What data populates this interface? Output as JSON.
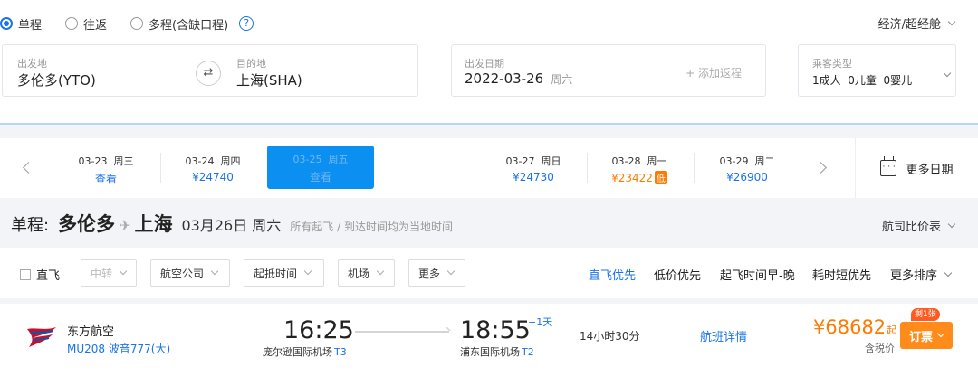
{
  "trip_types": [
    "单程",
    "往返",
    "多程(含缺口程)"
  ],
  "cabin": "经济/超经舱",
  "search": {
    "from_label": "出发地",
    "from_value": "多伦多(YTO)",
    "to_label": "目的地",
    "to_value": "上海(SHA)",
    "date_label": "出发日期",
    "date_value": "2022-03-26",
    "date_weekday": "周六",
    "add_return": "+ 添加返程",
    "pax_label": "乘客类型",
    "pax_value": "1成人  0儿童  0婴儿"
  },
  "dates": [
    {
      "date": "03-23  周三",
      "price": "查看"
    },
    {
      "date": "03-24  周四",
      "price": "¥24740"
    },
    {
      "date": "03-25  周五",
      "price": "查看"
    },
    {
      "date": "03-27  周日",
      "price": "¥24730"
    },
    {
      "date": "03-28  周一",
      "price": "¥23422",
      "tag": "低"
    },
    {
      "date": "03-29  周二",
      "price": "¥26900"
    }
  ],
  "more_dates": "更多日期",
  "route": {
    "prefix": "单程:",
    "from": "多伦多",
    "to": "上海",
    "date": "03月26日 周六",
    "note": "所有起飞 / 到达时间均为当地时间"
  },
  "compare": "航司比价表",
  "filters": {
    "direct": "直飞",
    "selects": [
      "中转",
      "航空公司",
      "起抵时间",
      "机场",
      "更多"
    ],
    "sorts": [
      "直飞优先",
      "低价优先",
      "起飞时间早-晚",
      "耗时短优先",
      "更多排序"
    ]
  },
  "flight": {
    "airline": "东方航空",
    "flight_no": "MU208 波音777(大)",
    "dep_time": "16:25",
    "arr_time": "18:55",
    "plus_day": "+1天",
    "dep_airport": "庞尔逊国际机场",
    "dep_terminal": "T3",
    "arr_airport": "浦东国际机场",
    "arr_terminal": "T2",
    "duration": "14小时30分",
    "details": "航班详情",
    "price": "¥68682",
    "price_suffix": "起",
    "tax": "含税价",
    "remain": "剩1张",
    "book": "订票"
  },
  "colors": {
    "accent": "#1a73e8",
    "price": "#ff7a00",
    "selected_date": "#0b8ff0"
  }
}
